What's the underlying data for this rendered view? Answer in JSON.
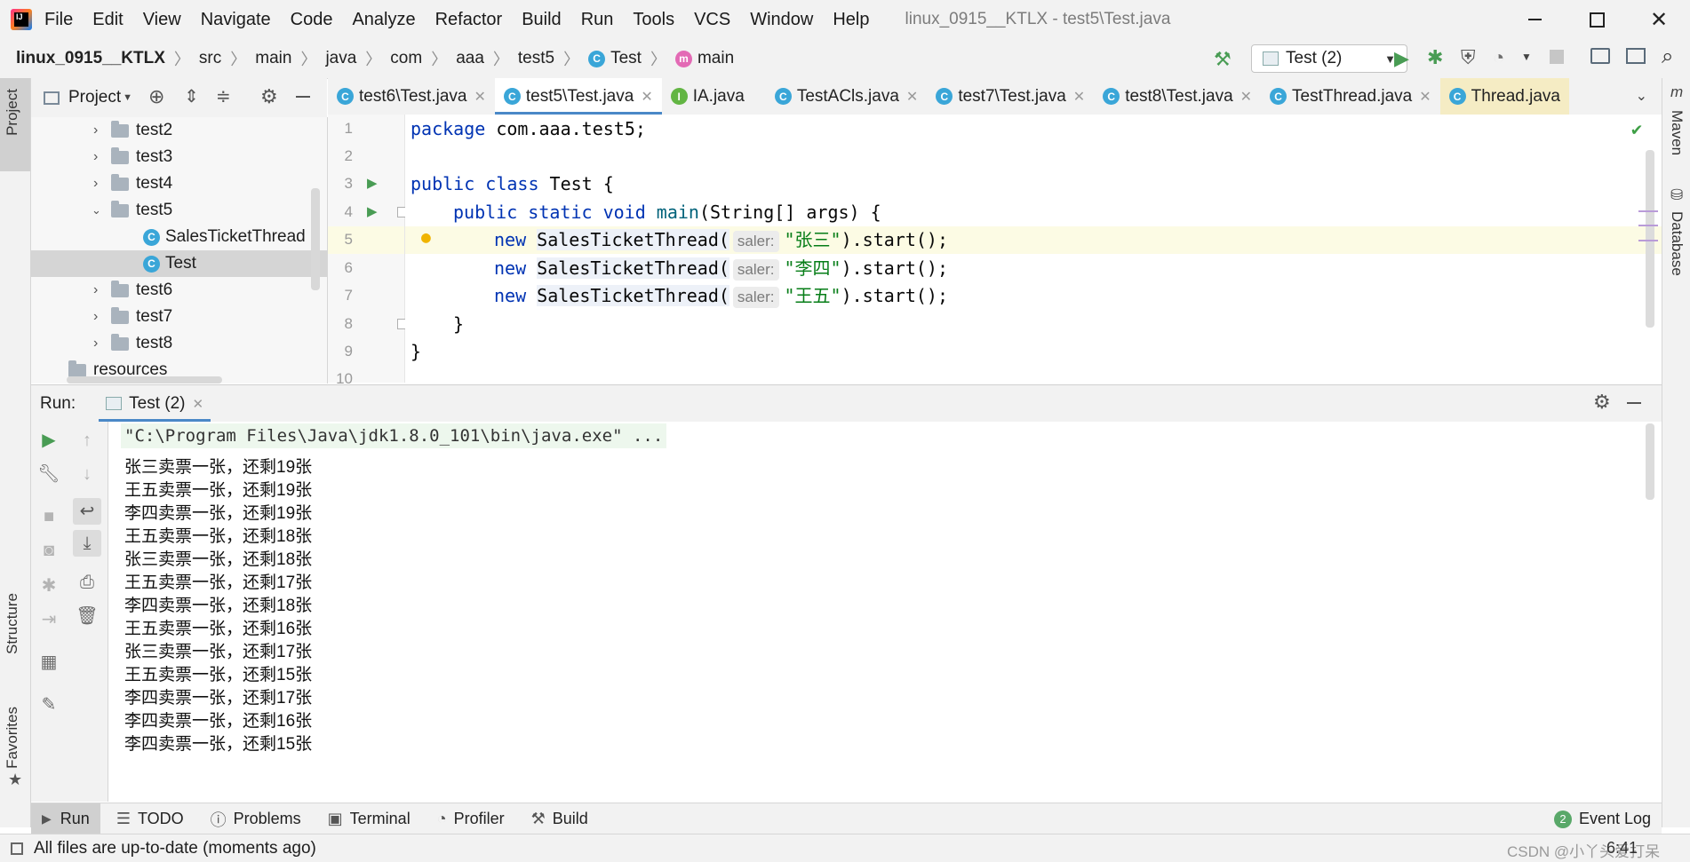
{
  "menu": [
    "File",
    "Edit",
    "View",
    "Navigate",
    "Code",
    "Analyze",
    "Refactor",
    "Build",
    "Run",
    "Tools",
    "VCS",
    "Window",
    "Help"
  ],
  "window_title": "linux_0915__KTLX - test5\\Test.java",
  "breadcrumb": [
    "linux_0915__KTLX",
    "src",
    "main",
    "java",
    "com",
    "aaa",
    "test5",
    "Test",
    "main"
  ],
  "run_config": "Test (2)",
  "project_panel": {
    "title": "Project",
    "tree": [
      {
        "label": "test2",
        "type": "folder",
        "expanded": false
      },
      {
        "label": "test3",
        "type": "folder",
        "expanded": false
      },
      {
        "label": "test4",
        "type": "folder",
        "expanded": false
      },
      {
        "label": "test5",
        "type": "folder",
        "expanded": true
      },
      {
        "label": "SalesTicketThread",
        "type": "class"
      },
      {
        "label": "Test",
        "type": "class",
        "selected": true
      },
      {
        "label": "test6",
        "type": "folder",
        "expanded": false
      },
      {
        "label": "test7",
        "type": "folder",
        "expanded": false
      },
      {
        "label": "test8",
        "type": "folder",
        "expanded": false
      },
      {
        "label": "resources",
        "type": "folder"
      }
    ]
  },
  "editor_tabs": [
    {
      "label": "test6\\Test.java"
    },
    {
      "label": "test5\\Test.java",
      "active": true
    },
    {
      "label": "IA.java",
      "icon": "I"
    },
    {
      "label": "TestACls.java"
    },
    {
      "label": "test7\\Test.java"
    },
    {
      "label": "test8\\Test.java"
    },
    {
      "label": "TestThread.java"
    },
    {
      "label": "Thread.java"
    }
  ],
  "code": {
    "line_numbers": [
      "1",
      "2",
      "3",
      "4",
      "5",
      "6",
      "7",
      "8",
      "9",
      "10"
    ],
    "l1_kw": "package",
    "l1_rest": " com.aaa.test5;",
    "l3_kw": "public class",
    "l3_rest": " Test {",
    "l4_kw": "public static void",
    "l4_fn": "main",
    "l4_rest": "(String[] args) {",
    "new_kw": "new",
    "call": "SalesTicketThread(",
    "hint": "saler:",
    "args": [
      "\"张三\"",
      "\"李四\"",
      "\"王五\""
    ],
    "tail": ").start();",
    "l8": "}",
    "l9": "}"
  },
  "run_panel": {
    "label": "Run:",
    "tab": "Test (2)",
    "command": "\"C:\\Program Files\\Java\\jdk1.8.0_101\\bin\\java.exe\" ...",
    "output": [
      "张三卖票一张，还剩19张",
      "王五卖票一张，还剩19张",
      "李四卖票一张，还剩19张",
      "王五卖票一张，还剩18张",
      "张三卖票一张，还剩18张",
      "王五卖票一张，还剩17张",
      "李四卖票一张，还剩18张",
      "王五卖票一张，还剩16张",
      "张三卖票一张，还剩17张",
      "王五卖票一张，还剩15张",
      "李四卖票一张，还剩17张",
      "李四卖票一张，还剩16张",
      "李四卖票一张，还剩15张"
    ]
  },
  "bottom_tabs": [
    "Run",
    "TODO",
    "Problems",
    "Terminal",
    "Profiler",
    "Build"
  ],
  "event_log": {
    "count": "2",
    "label": "Event Log"
  },
  "status": "All files are up-to-date (moments ago)",
  "position": "6:41",
  "watermark": "CSDN @小丫头爱打呆",
  "side_tabs": {
    "project": "Project",
    "structure": "Structure",
    "favorites": "Favorites",
    "maven": "Maven",
    "database": "Database"
  }
}
